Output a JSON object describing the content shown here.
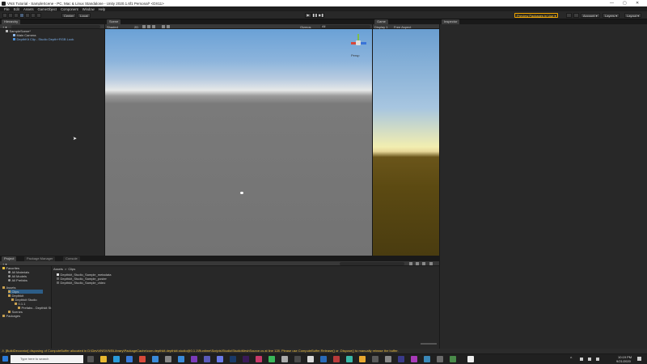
{
  "window": {
    "title": "VNS Tutorial - SampleScene - PC, Mac & Linux Standalone - Unity 2020.1.6f1 Personal* <DX11>",
    "controls": [
      "—",
      "▢",
      "✕"
    ]
  },
  "menu": [
    "File",
    "Edit",
    "Assets",
    "GameObject",
    "Component",
    "Window",
    "Help"
  ],
  "toolbar": {
    "center_label": "Center",
    "local_label": "Local",
    "preview_packages": "Preview Packages in Use ▾",
    "account_label": "Account ▾",
    "layers_label": "Layers ▾",
    "layout_label": "Layout ▾"
  },
  "hierarchy": {
    "tab": "Hierarchy",
    "items": [
      {
        "label": "SampleScene*",
        "selected": false
      },
      {
        "label": "Main Camera",
        "selected": false
      },
      {
        "label": "DepthKit Clip - Studio Depth+RGB Look",
        "selected": true
      }
    ]
  },
  "scene": {
    "tab": "Scene",
    "shading": "Shaded",
    "mode_2d": "2D",
    "gizmos": "Gizmos",
    "search": "All",
    "persp": "Persp"
  },
  "game": {
    "tab": "Game",
    "display": "Display 1",
    "aspect": "Free Aspect"
  },
  "inspector": {
    "tab": "Inspector"
  },
  "project": {
    "tabs": [
      "Project",
      "Package Manager",
      "Console"
    ],
    "breadcrumb": [
      "Assets",
      "Clips"
    ],
    "tree": [
      {
        "label": "Favorites",
        "indent": 0
      },
      {
        "label": "All Materials",
        "indent": 1
      },
      {
        "label": "All Models",
        "indent": 1
      },
      {
        "label": "All Prefabs",
        "indent": 1
      },
      {
        "label": "Assets",
        "indent": 0
      },
      {
        "label": "Clips",
        "indent": 1,
        "selected": true
      },
      {
        "label": "Depthkit",
        "indent": 1
      },
      {
        "label": "Depthkit Studio",
        "indent": 2
      },
      {
        "label": "0.1.1",
        "indent": 3
      },
      {
        "label": "Prefabs - Depthkit St",
        "indent": 4
      },
      {
        "label": "Scenes",
        "indent": 1
      },
      {
        "label": "Packages",
        "indent": 0
      }
    ],
    "files": [
      "Depthkit_Studio_Sample_metadata",
      "Depthkit_Studio_Sample_poster",
      "Depthkit_Studio_Sample_video"
    ]
  },
  "status": {
    "message": "[BuildDecorator] disposing of ComputeBuffer allocated in D:\\Dev\\VNS\\VNS\\Library\\PackageCache\\com.depthkit.depthkit.studio@0.1.1\\Runtime\\Scripts\\Studio\\StudioMeshSource.cs at line 128. Please use ComputeBuffer.Release() or .Dispose() to manually release the buffer."
  },
  "taskbar": {
    "search_placeholder": "Type here to search",
    "time": "10:19 PM",
    "date": "9/21/2020"
  }
}
